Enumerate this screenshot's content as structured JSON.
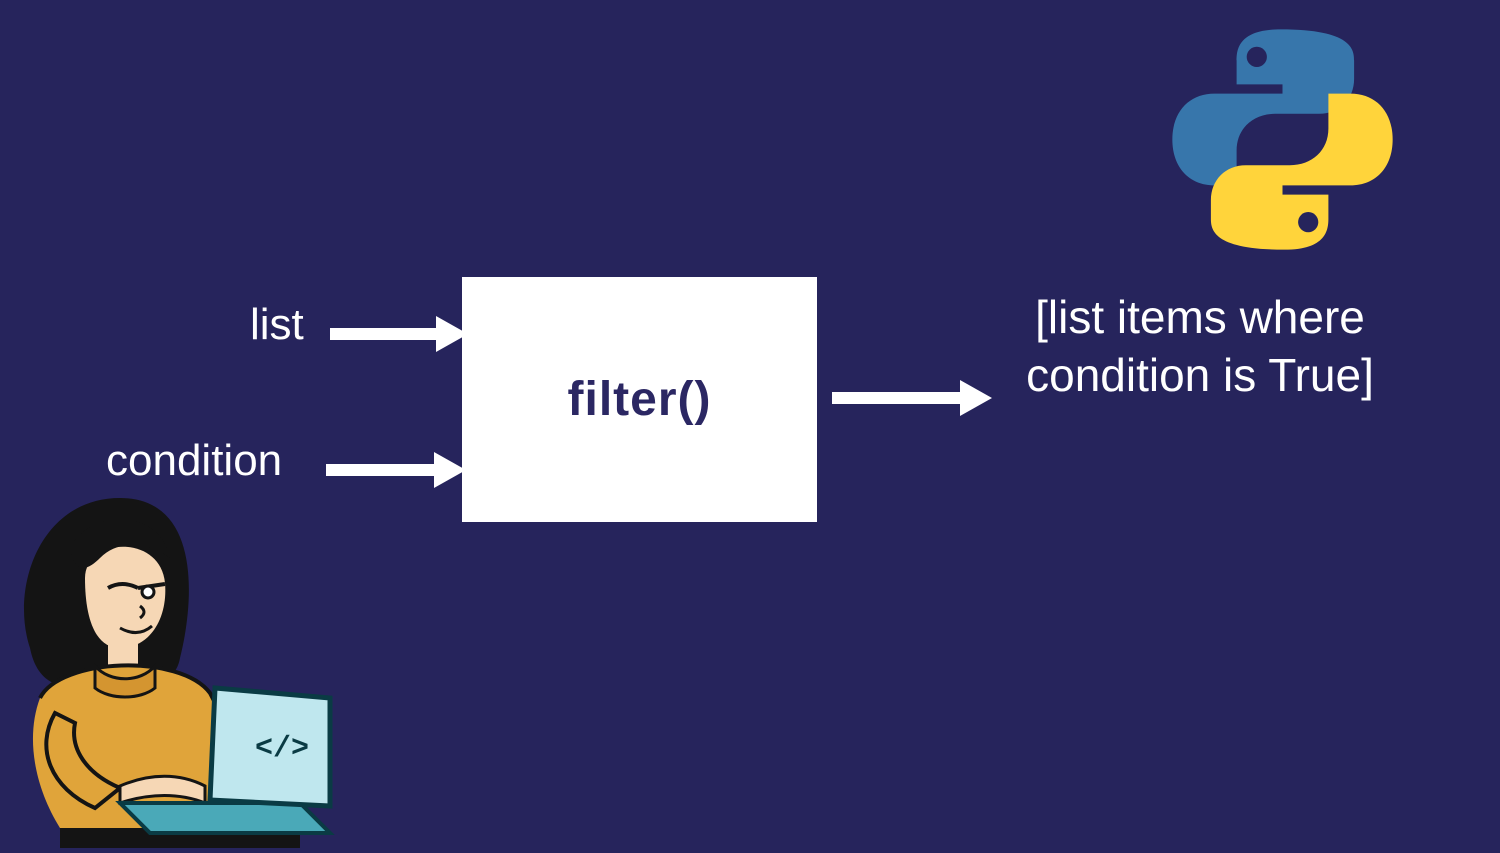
{
  "inputs": {
    "list_label": "list",
    "condition_label": "condition"
  },
  "function_box": {
    "name": "filter()"
  },
  "output": {
    "text": "[list items where condition is True]"
  },
  "colors": {
    "background": "#26245c",
    "box_bg": "#ffffff",
    "box_text": "#2b2763",
    "label_text": "#ffffff",
    "arrow": "#ffffff",
    "python_blue": "#3776ab",
    "python_yellow": "#ffd43b"
  },
  "icons": {
    "python": "python-logo-icon",
    "arrow": "arrow-right-icon",
    "illustration": "person-with-laptop-illustration"
  }
}
